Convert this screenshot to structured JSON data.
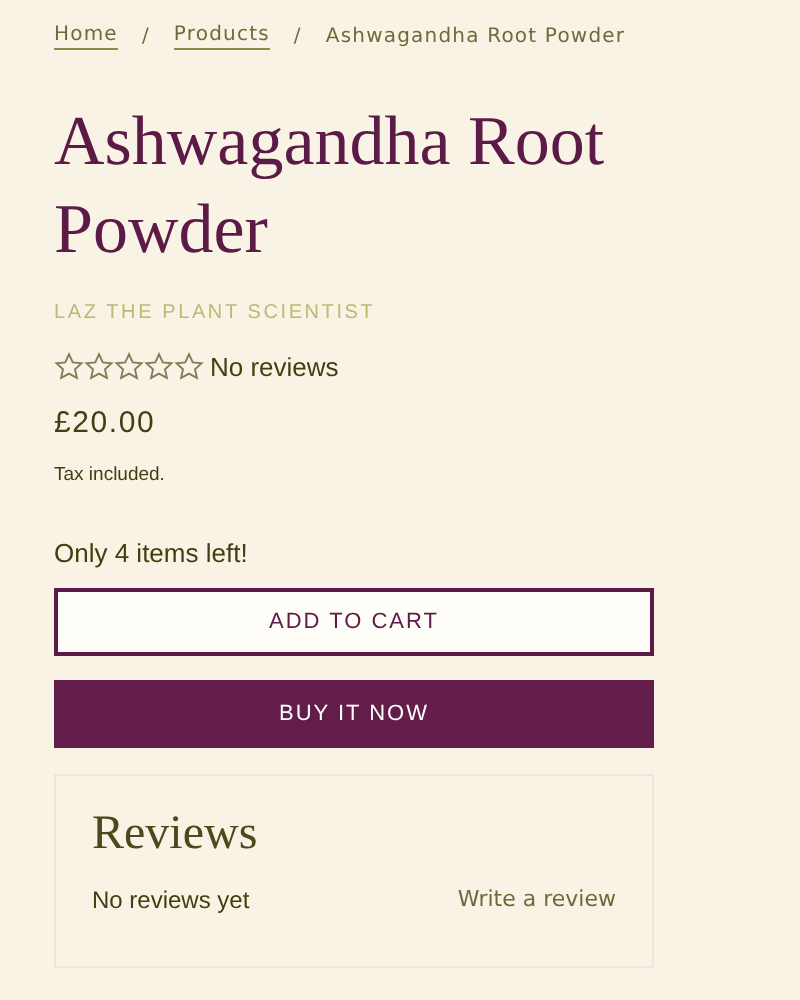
{
  "breadcrumb": [
    {
      "label": "Home",
      "kind": "link"
    },
    {
      "label": "Products",
      "kind": "link"
    },
    {
      "label": "Ashwagandha Root Powder",
      "kind": "current"
    }
  ],
  "breadcrumb_separator": "/",
  "product": {
    "title": "Ashwagandha Root Powder",
    "vendor": "LAZ THE PLANT SCIENTIST",
    "stars": 0,
    "reviews_label": "No reviews",
    "price": "£20.00",
    "tax_note": "Tax included.",
    "stock_note": "Only 4 items left!"
  },
  "buttons": [
    {
      "label": "ADD TO CART",
      "kind": "outline"
    },
    {
      "label": "BUY IT NOW",
      "kind": "solid"
    }
  ],
  "reviews": {
    "title": "Reviews",
    "empty_text": "No reviews yet",
    "write_link": "Write a review"
  }
}
